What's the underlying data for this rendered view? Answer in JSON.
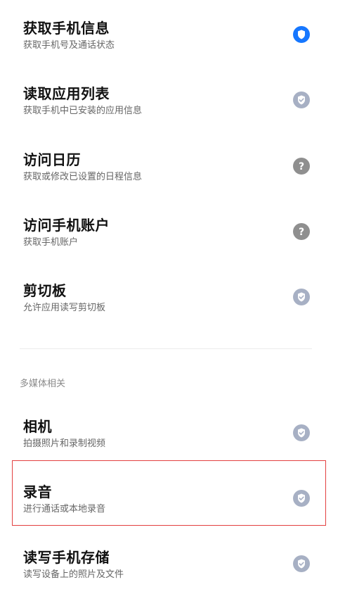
{
  "colors": {
    "allowed": "#1677ff",
    "partial": "#a7b0c4",
    "unknown": "#8f8f8f",
    "highlight": "#e34040"
  },
  "permissions": [
    {
      "title": "获取手机信息",
      "subtitle": "获取手机号及通话状态",
      "status": "allowed",
      "icon": "shield-icon"
    },
    {
      "title": "读取应用列表",
      "subtitle": "获取手机中已安装的应用信息",
      "status": "partial",
      "icon": "check-icon"
    },
    {
      "title": "访问日历",
      "subtitle": "获取或修改已设置的日程信息",
      "status": "unknown",
      "icon": "question-icon"
    },
    {
      "title": "访问手机账户",
      "subtitle": "获取手机账户",
      "status": "unknown",
      "icon": "question-icon"
    },
    {
      "title": "剪切板",
      "subtitle": "允许应用读写剪切板",
      "status": "partial",
      "icon": "check-icon"
    }
  ],
  "media_section": {
    "header": "多媒体相关",
    "items": [
      {
        "title": "相机",
        "subtitle": "拍摄照片和录制视频",
        "status": "partial",
        "icon": "check-icon"
      },
      {
        "title": "录音",
        "subtitle": "进行通话或本地录音",
        "status": "partial",
        "icon": "check-icon"
      },
      {
        "title": "读写手机存储",
        "subtitle": "读写设备上的照片及文件",
        "status": "partial",
        "icon": "check-icon"
      }
    ]
  }
}
